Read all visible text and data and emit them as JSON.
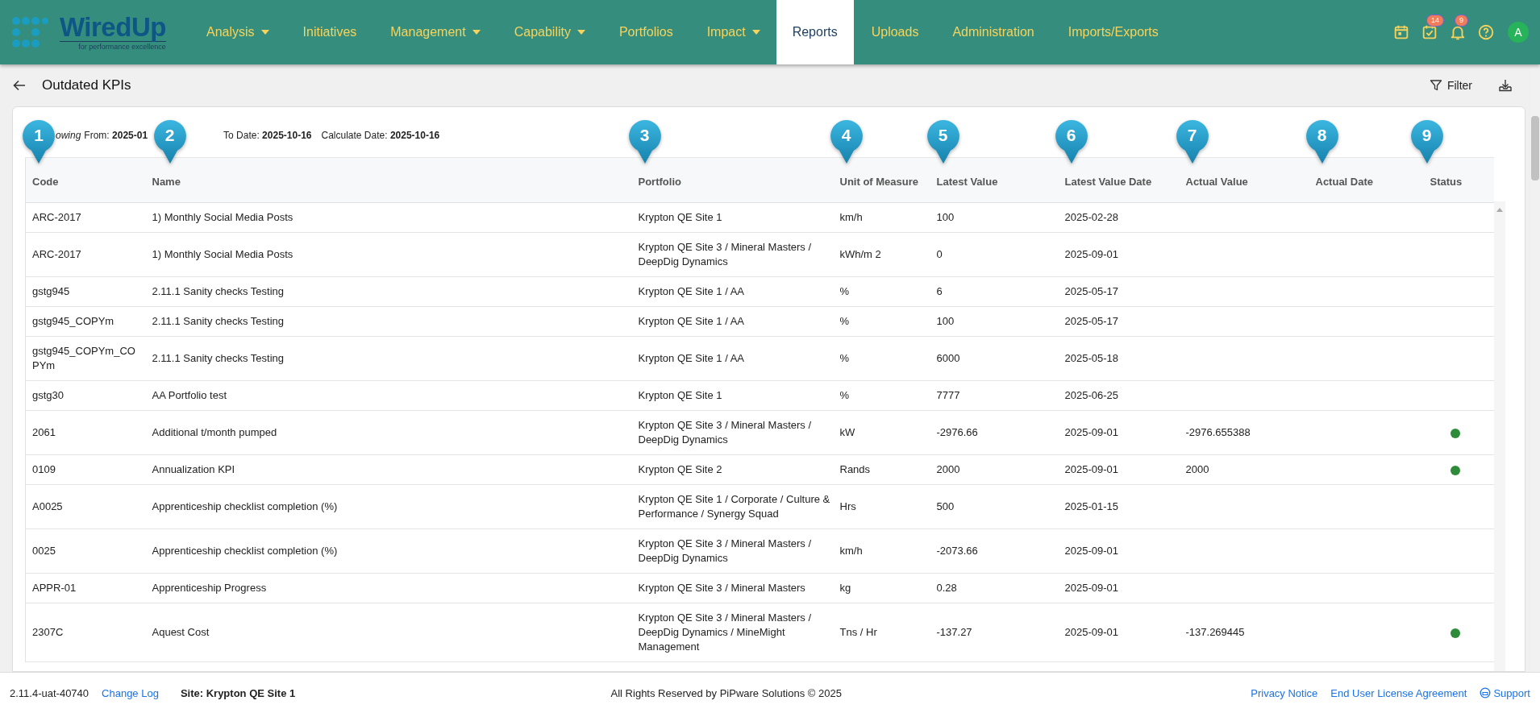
{
  "logo": {
    "name": "WiredUp",
    "tagline": "for performance excellence"
  },
  "nav": [
    {
      "label": "Analysis",
      "has_menu": true,
      "selected": false
    },
    {
      "label": "Initiatives",
      "has_menu": false,
      "selected": false
    },
    {
      "label": "Management",
      "has_menu": true,
      "selected": false
    },
    {
      "label": "Capability",
      "has_menu": true,
      "selected": false
    },
    {
      "label": "Portfolios",
      "has_menu": false,
      "selected": false
    },
    {
      "label": "Impact",
      "has_menu": true,
      "selected": false
    },
    {
      "label": "Reports",
      "has_menu": false,
      "selected": true
    },
    {
      "label": "Uploads",
      "has_menu": false,
      "selected": false
    },
    {
      "label": "Administration",
      "has_menu": false,
      "selected": false
    },
    {
      "label": "Imports/Exports",
      "has_menu": false,
      "selected": false
    }
  ],
  "header_icons": [
    {
      "kind": "calendar"
    },
    {
      "kind": "tasks",
      "badge": "14"
    },
    {
      "kind": "bell",
      "badge": "9"
    },
    {
      "kind": "help"
    },
    {
      "kind": "avatar",
      "initial": "A"
    }
  ],
  "page_title": "Outdated KPIs",
  "toolbar": {
    "filter": "Filter"
  },
  "criteria": [
    "*owing*",
    "From: **2025-01**",
    "To Date: **2025-10-16**",
    "Calculate Date: **2025-10-16**"
  ],
  "table": {
    "columns": [
      {
        "label": "Code",
        "callout": "1"
      },
      {
        "label": "Name",
        "callout": "2"
      },
      {
        "label": "Portfolio",
        "callout": "3"
      },
      {
        "label": "Unit of Measure",
        "callout": "4"
      },
      {
        "label": "Latest Value",
        "callout": "5"
      },
      {
        "label": "Latest Value Date",
        "callout": "6"
      },
      {
        "label": "Actual Value",
        "callout": "7"
      },
      {
        "label": "Actual Date",
        "callout": "8"
      },
      {
        "label": "Status",
        "callout": "9"
      }
    ],
    "rows": [
      {
        "cells": [
          "ARC-2017",
          "1) Monthly Social Media Posts",
          "Krypton QE Site 1",
          "km/h",
          "100",
          "2025-02-28",
          "",
          ""
        ]
      },
      {
        "cells": [
          "ARC-2017",
          "1) Monthly Social Media Posts",
          "Krypton QE Site 3 / Mineral Masters / DeepDig Dynamics",
          "kWh/m 2",
          "0",
          "2025-09-01",
          "",
          ""
        ]
      },
      {
        "cells": [
          "gstg945",
          "2.11.1 Sanity checks Testing",
          "Krypton QE Site 1 / AA",
          "%",
          "6",
          "2025-05-17",
          "",
          ""
        ]
      },
      {
        "cells": [
          "gstg945_COPYm",
          "2.11.1 Sanity checks Testing",
          "Krypton QE Site 1 / AA",
          "%",
          "100",
          "2025-05-17",
          "",
          ""
        ]
      },
      {
        "cells": [
          "gstg945_COPYm_COPYm",
          "2.11.1 Sanity checks Testing",
          "Krypton QE Site 1 / AA",
          "%",
          "6000",
          "2025-05-18",
          "",
          ""
        ]
      },
      {
        "cells": [
          "gstg30",
          "AA Portfolio test",
          "Krypton QE Site 1",
          "%",
          "7777",
          "2025-06-25",
          "",
          ""
        ]
      },
      {
        "cells": [
          "2061",
          "Additional t/month pumped",
          "Krypton QE Site 3 / Mineral Masters / DeepDig Dynamics",
          "kW",
          "-2976.66",
          "2025-09-01",
          "-2976.655388",
          ""
        ],
        "color": "#2e8b3a"
      },
      {
        "cells": [
          "0109",
          "Annualization KPI",
          "Krypton QE Site 2",
          "Rands",
          "2000",
          "2025-09-01",
          "2000",
          ""
        ],
        "color": "#2e8b3a"
      },
      {
        "cells": [
          "A0025",
          "Apprenticeship checklist completion (%)",
          "Krypton QE Site 1 / Corporate / Culture & Performance / Synergy Squad",
          "Hrs",
          "500",
          "2025-01-15",
          "",
          ""
        ]
      },
      {
        "cells": [
          "0025",
          "Apprenticeship checklist completion (%)",
          "Krypton QE Site 3 / Mineral Masters / DeepDig Dynamics",
          "km/h",
          "-2073.66",
          "2025-09-01",
          "",
          ""
        ]
      },
      {
        "cells": [
          "APPR-01",
          "Apprenticeship Progress",
          "Krypton QE Site 3 / Mineral Masters",
          "kg",
          "0.28",
          "2025-09-01",
          "",
          ""
        ]
      },
      {
        "cells": [
          "2307C",
          "Aquest Cost",
          "Krypton QE Site 3 / Mineral Masters / DeepDig Dynamics / MineMight Management",
          "Tns / Hr",
          "-137.27",
          "2025-09-01",
          "-137.269445",
          ""
        ],
        "color": "#2e8b3a"
      }
    ]
  },
  "footer": {
    "version": "2.11.4-uat-40740",
    "change_log": "Change Log",
    "site": "Site: Krypton QE Site 1",
    "copyright": "All Rights Reserved by PiPware Solutions © 2025",
    "links": [
      "Privacy Notice",
      "End User License Agreement"
    ],
    "support": "Support"
  }
}
